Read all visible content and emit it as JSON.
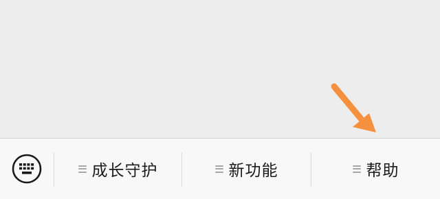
{
  "menu": {
    "keyboard_icon": "keyboard-icon",
    "items": [
      {
        "label": "成长守护",
        "icon": "menu-lines-icon"
      },
      {
        "label": "新功能",
        "icon": "menu-lines-icon"
      },
      {
        "label": "帮助",
        "icon": "menu-lines-icon"
      }
    ]
  },
  "colors": {
    "background": "#ededed",
    "menu_background": "#f8f8f8",
    "annotation_arrow": "#f5913e",
    "icon": "#1a1a1a",
    "menu_lines": "#a6a6a6"
  }
}
